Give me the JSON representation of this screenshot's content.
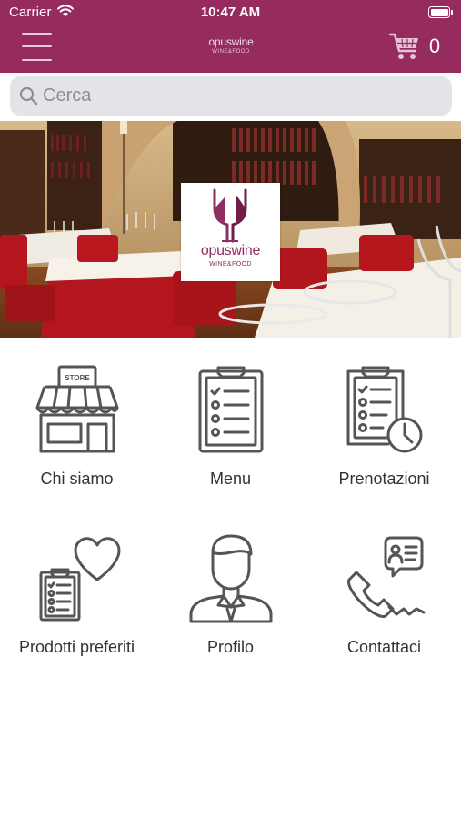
{
  "status_bar": {
    "carrier": "Carrier",
    "time": "10:47 AM"
  },
  "nav_bar": {
    "brand_name": "opuswine",
    "brand_sub": "WINE&FOOD",
    "cart_count": "0",
    "color": "#962b5e"
  },
  "search": {
    "placeholder": "Cerca"
  },
  "hero": {
    "logo_name": "opuswine",
    "logo_sub": "WINE&FOOD"
  },
  "menu_tiles": [
    {
      "label": "Chi siamo",
      "icon": "store-icon"
    },
    {
      "label": "Menu",
      "icon": "clipboard-checklist-icon"
    },
    {
      "label": "Prenotazioni",
      "icon": "clipboard-clock-icon"
    },
    {
      "label": "Prodotti preferiti",
      "icon": "clipboard-heart-icon"
    },
    {
      "label": "Profilo",
      "icon": "user-profile-icon"
    },
    {
      "label": "Contattaci",
      "icon": "phone-contact-icon"
    }
  ]
}
